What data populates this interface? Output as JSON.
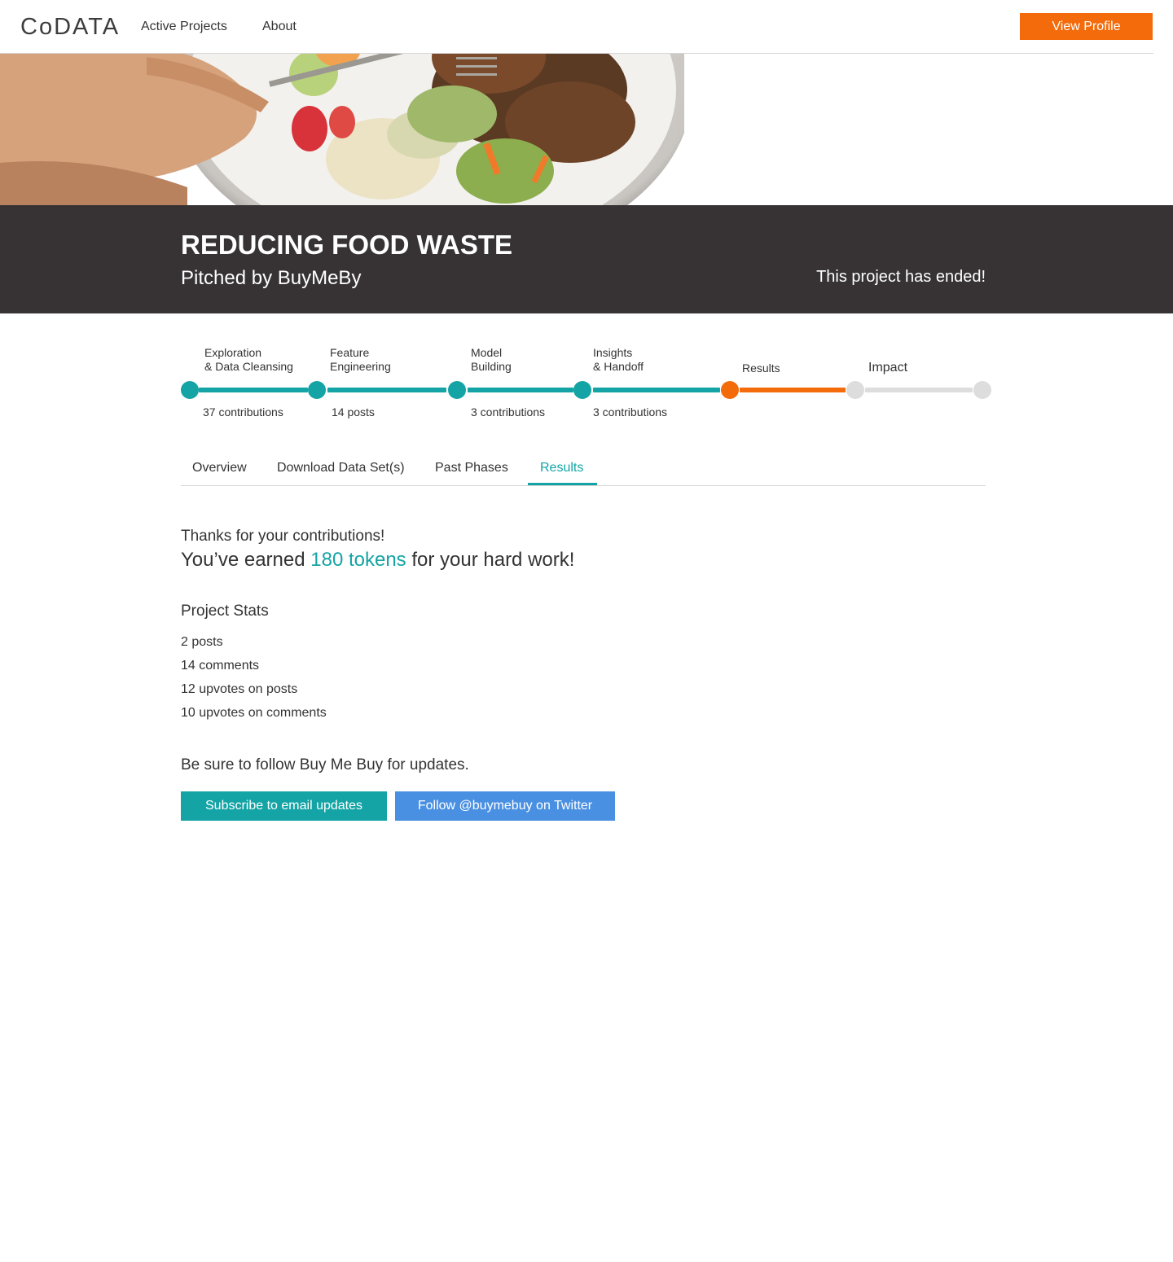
{
  "header": {
    "logo": "CoDATA",
    "nav": [
      {
        "label": "Active Projects"
      },
      {
        "label": "About"
      }
    ],
    "profile_button": "View Profile"
  },
  "banner": {
    "title": "REDUCING FOOD WASTE",
    "pitched_by": "Pitched by BuyMeBy",
    "status": "This project has ended!"
  },
  "phases": [
    {
      "label_line1": "Exploration",
      "label_line2": "& Data Cleansing",
      "count": "37 contributions",
      "state": "complete"
    },
    {
      "label_line1": "Feature",
      "label_line2": "Engineering",
      "count": "14 posts",
      "state": "complete"
    },
    {
      "label_line1": "Model",
      "label_line2": "Building",
      "count": "3 contributions",
      "state": "complete"
    },
    {
      "label_line1": "Insights",
      "label_line2": "& Handoff",
      "count": "3 contributions",
      "state": "complete"
    },
    {
      "label_line1": "Results",
      "label_line2": "",
      "count": "",
      "state": "current"
    },
    {
      "label_line1": "Impact",
      "label_line2": "",
      "count": "",
      "state": "upcoming"
    }
  ],
  "tabs": [
    {
      "label": "Overview",
      "active": false
    },
    {
      "label": "Download Data Set(s)",
      "active": false
    },
    {
      "label": "Past Phases",
      "active": false
    },
    {
      "label": "Results",
      "active": true
    }
  ],
  "results": {
    "thanks": "Thanks for your contributions!",
    "earned_prefix": "You’ve earned ",
    "tokens": "180 tokens",
    "earned_suffix": " for your hard work!",
    "stats_title": "Project Stats",
    "stats": [
      "2 posts",
      "14 comments",
      "12 upvotes on posts",
      "10 upvotes on comments"
    ],
    "follow_note": "Be sure to follow Buy Me Buy for updates.",
    "subscribe_button": "Subscribe to email updates",
    "twitter_button": "Follow @buymebuy on Twitter"
  },
  "colors": {
    "teal": "#14a4a5",
    "orange": "#f36b0a",
    "upcoming": "#dddddd",
    "banner": "#373334",
    "twitter": "#4a90e2"
  }
}
